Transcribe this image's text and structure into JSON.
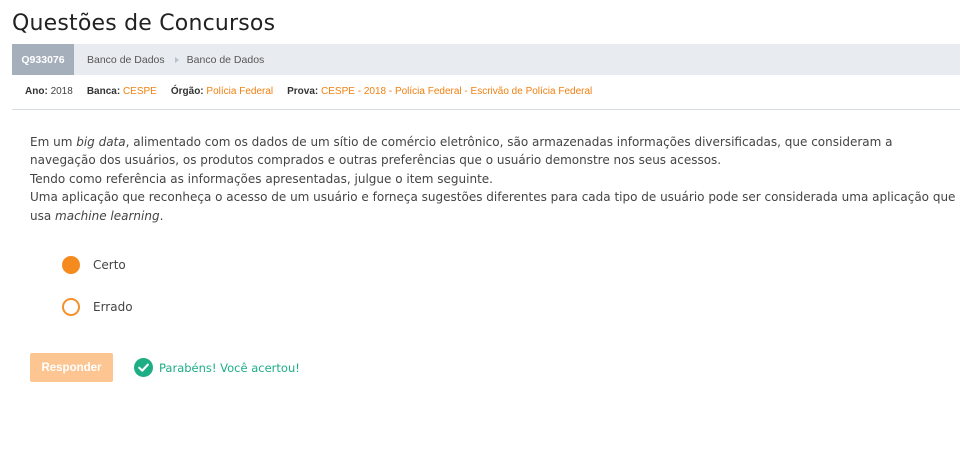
{
  "page": {
    "title": "Questões de Concursos"
  },
  "header": {
    "question_id": "Q933076",
    "breadcrumb": [
      "Banco de Dados",
      "Banco de Dados"
    ]
  },
  "meta": {
    "ano_label": "Ano:",
    "ano_value": "2018",
    "banca_label": "Banca:",
    "banca_value": "CESPE",
    "orgao_label": "Órgão:",
    "orgao_value": "Polícia Federal",
    "prova_label": "Prova:",
    "prova_value": "CESPE - 2018 - Polícia Federal - Escrivão de Polícia Federal"
  },
  "question": {
    "p1_before": "Em um ",
    "p1_em": "big data",
    "p1_after": ", alimentado com os dados de um sítio de comércio eletrônico, são armazenadas informações diversificadas, que consideram a navegação dos usuários, os produtos comprados e outras preferências que o usuário demonstre nos seus acessos.",
    "p2": "Tendo como referência as informações apresentadas, julgue o item seguinte.",
    "p3_before": "Uma aplicação que reconheça o acesso de um usuário e forneça sugestões diferentes para cada tipo de usuário pode ser considerada uma aplicação que usa ",
    "p3_em": "machine learning",
    "p3_after": "."
  },
  "options": [
    {
      "label": "Certo",
      "selected": true
    },
    {
      "label": "Errado",
      "selected": false
    }
  ],
  "actions": {
    "respond_label": "Responder"
  },
  "feedback": {
    "text": "Parabéns! Você acertou!",
    "icon": "check-circle-icon"
  },
  "colors": {
    "accent": "#f58b1f",
    "link": "#f08010",
    "success": "#1dae85",
    "qid_bg": "#a5aebb",
    "header_bg": "#e8ecf0",
    "button_disabled": "#fcc591"
  }
}
